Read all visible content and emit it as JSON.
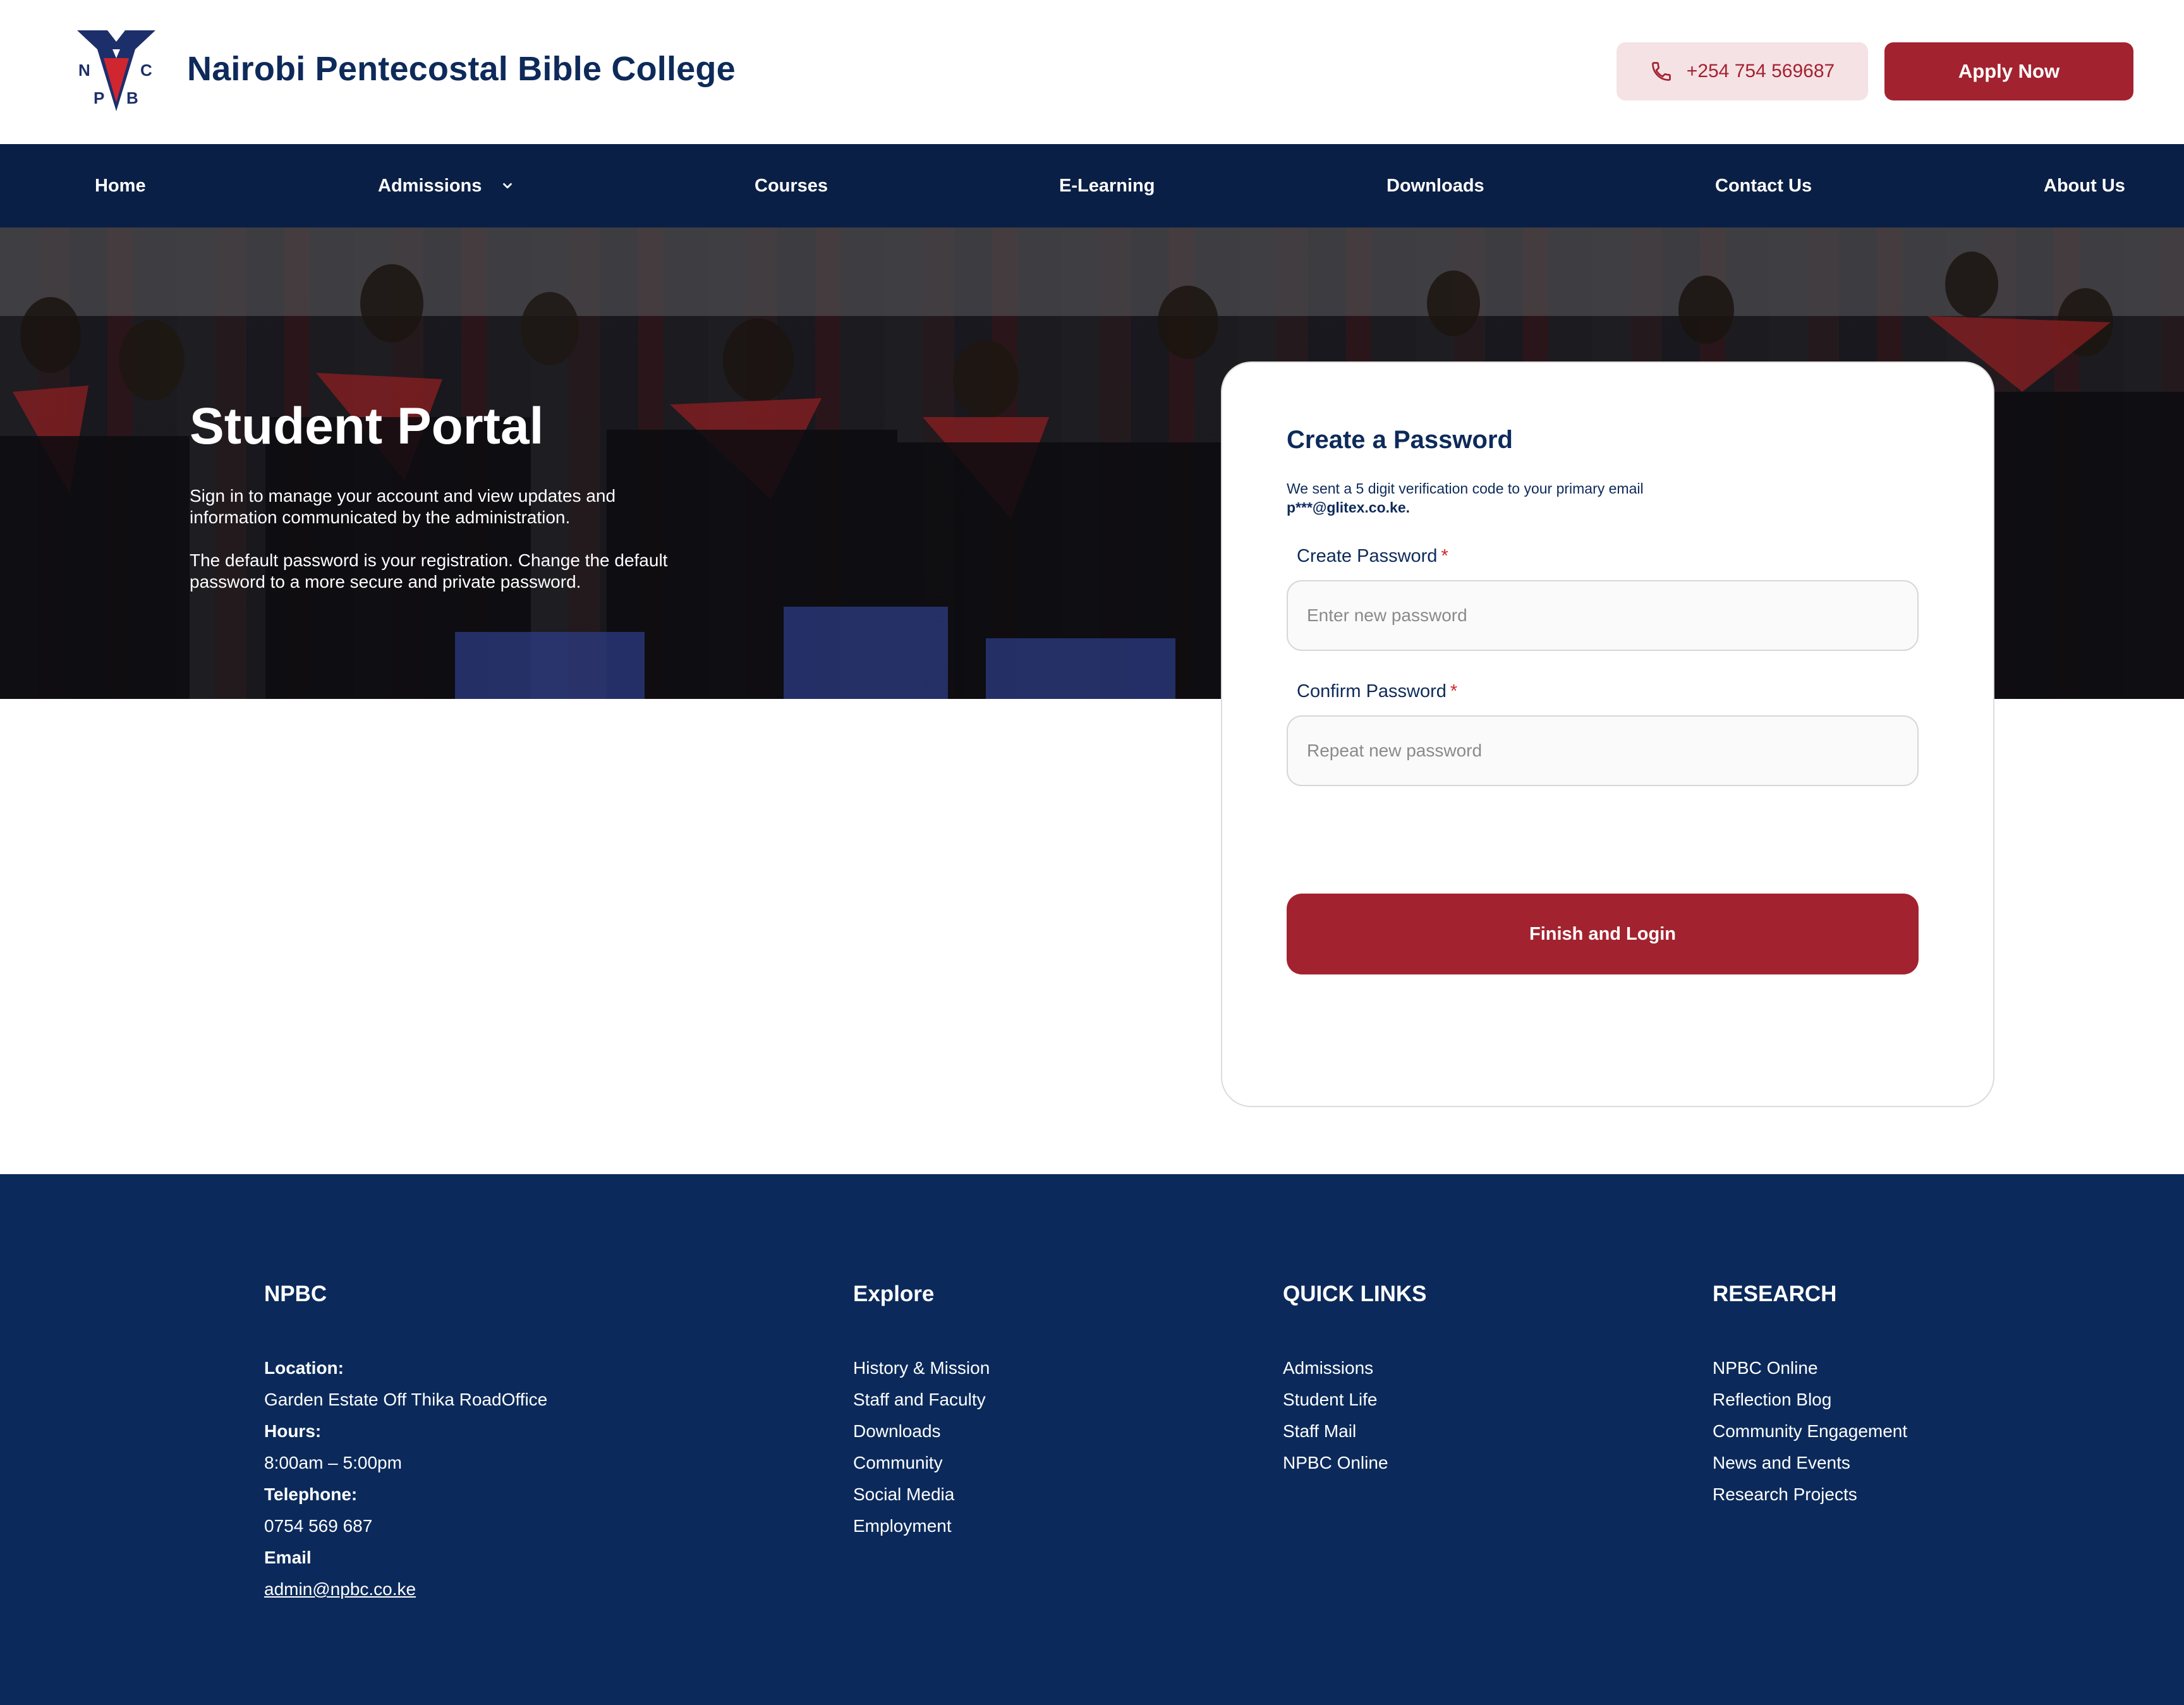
{
  "header": {
    "brand_title": "Nairobi Pentecostal Bible College",
    "logo_letters": [
      "N",
      "C",
      "P",
      "B"
    ],
    "phone_label": "+254 754 569687",
    "apply_label": "Apply Now",
    "colors": {
      "navy": "#0d2a5a",
      "accent": "#a3222f",
      "phone_bg": "#f4e2e5"
    }
  },
  "nav": {
    "items": [
      {
        "label": "Home"
      },
      {
        "label": "Admissions"
      },
      {
        "label": "Courses"
      },
      {
        "label": "E-Learning"
      },
      {
        "label": "Downloads"
      },
      {
        "label": "Contact Us"
      },
      {
        "label": "About Us"
      }
    ],
    "bg_color": "#0a1f45"
  },
  "hero": {
    "title": "Student Portal",
    "paragraph1": "Sign in to manage your account and view updates and information communicated by the administration.",
    "paragraph2": "The default password is your registration. Change the default password to a more secure and private password."
  },
  "card": {
    "title": "Create a Password",
    "subtitle_prefix": "We sent a 5 digit verification code to your primary email ",
    "subtitle_email": "p***@glitex.co.ke.",
    "create_label": "Create Password",
    "create_placeholder": "Enter new password",
    "confirm_label": "Confirm Password",
    "confirm_placeholder": "Repeat new password",
    "required_mark": "*",
    "submit_label": "Finish and Login"
  },
  "footer": {
    "bg_color": "#0b2a5b",
    "npbc": {
      "heading": "NPBC",
      "location_label": "Location:",
      "location_value": "Garden Estate Off Thika RoadOffice",
      "hours_label": "Hours:",
      "hours_value": "8:00am – 5:00pm",
      "telephone_label": "Telephone:",
      "telephone_value": "0754 569 687",
      "email_label": "Email",
      "email_value": "admin@npbc.co.ke"
    },
    "explore": {
      "heading": "Explore",
      "links": [
        "History & Mission",
        "Staff and Faculty",
        "Downloads",
        "Community",
        "Social Media",
        "Employment"
      ]
    },
    "quick_links": {
      "heading": "QUICK LINKS",
      "links": [
        "Admissions",
        "Student Life",
        "Staff Mail",
        "NPBC Online"
      ]
    },
    "research": {
      "heading": "RESEARCH",
      "links": [
        "NPBC Online",
        "Reflection Blog",
        "Community Engagement",
        "News and Events",
        "Research Projects"
      ]
    }
  }
}
